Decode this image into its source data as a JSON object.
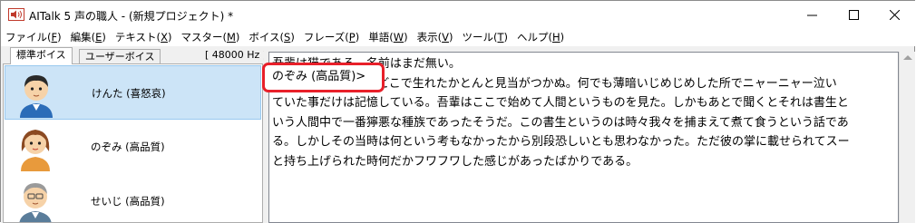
{
  "window": {
    "title": "AITalk 5 声の職人 - (新規プロジェクト) *"
  },
  "menu": [
    {
      "label": "ファイル(",
      "acc": "F",
      "end": ")"
    },
    {
      "label": "編集(",
      "acc": "E",
      "end": ")"
    },
    {
      "label": "テキスト(",
      "acc": "X",
      "end": ")"
    },
    {
      "label": "マスター(",
      "acc": "M",
      "end": ")"
    },
    {
      "label": "ボイス(",
      "acc": "S",
      "end": ")"
    },
    {
      "label": "フレーズ(",
      "acc": "P",
      "end": ")"
    },
    {
      "label": "単語(",
      "acc": "W",
      "end": ")"
    },
    {
      "label": "表示(",
      "acc": "V",
      "end": ")"
    },
    {
      "label": "ツール(",
      "acc": "T",
      "end": ")"
    },
    {
      "label": "ヘルプ(",
      "acc": "H",
      "end": ")"
    }
  ],
  "voice_panel": {
    "tabs": [
      "標準ボイス",
      "ユーザーボイス"
    ],
    "active_tab": 0,
    "sample_rate": "[ 48000 Hz ]",
    "voices": [
      {
        "name": "けんた (喜怒哀)",
        "selected": true
      },
      {
        "name": "のぞみ (高品質)",
        "selected": false
      },
      {
        "name": "せいじ (高品質)",
        "selected": false
      }
    ]
  },
  "editor": {
    "voice_tag": "のぞみ (高品質)>",
    "lines": [
      "吾輩は猫である。名前はまだ無い。",
      "のぞみ (高品質)>　どこで生れたかとんと見当がつかぬ。何でも薄暗いじめじめした所でニャーニャー泣い",
      "ていた事だけは記憶している。吾輩はここで始めて人間というものを見た。しかもあとで聞くとそれは書生と",
      "いう人間中で一番獰悪な種族であったそうだ。この書生というのは時々我々を捕まえて煮て食うという話であ",
      "る。しかしその当時は何という考もなかったから別段恐しいとも思わなかった。ただ彼の掌に載せられてスー",
      "と持ち上げられた時何だかフワフワした感じがあったばかりである。"
    ]
  },
  "colors": {
    "selection": "#cce4f7",
    "highlight": "#e8202a"
  }
}
